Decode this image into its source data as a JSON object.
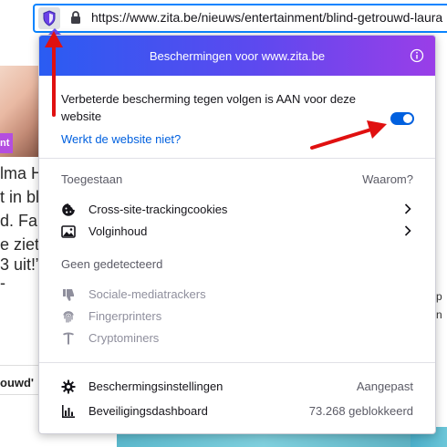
{
  "urlbar": {
    "url": "https://www.zita.be/nieuws/entertainment/blind-getrouwd-laura"
  },
  "background_page": {
    "badge": "nt",
    "lines": [
      "lma H",
      "t in bl",
      "d. Fan",
      "e ziet",
      "3 uit!”",
      "-"
    ],
    "bold_fragment": "ouwd'",
    "right_fragments": [
      "p",
      "n"
    ]
  },
  "panel": {
    "title": "Beschermingen voor www.zita.be",
    "status_message": "Verbeterde bescherming tegen volgen is AAN voor deze website",
    "toggle_on": true,
    "broken_link": "Werkt de website niet?",
    "allowed_heading": "Toegestaan",
    "why_link": "Waarom?",
    "allowed_items": [
      {
        "label": "Cross-site-trackingcookies",
        "icon": "cookie-icon"
      },
      {
        "label": "Volginhoud",
        "icon": "image-icon"
      }
    ],
    "not_detected_heading": "Geen gedetecteerd",
    "not_detected_items": [
      {
        "label": "Sociale-mediatrackers",
        "icon": "thumbs-down-icon"
      },
      {
        "label": "Fingerprinters",
        "icon": "fingerprint-icon"
      },
      {
        "label": "Cryptominers",
        "icon": "pickaxe-icon"
      }
    ],
    "settings_label": "Beschermingsinstellingen",
    "settings_value": "Aangepast",
    "dashboard_label": "Beveiligingsdashboard",
    "dashboard_value": "73.268 geblokkeerd"
  },
  "colors": {
    "accent_blue": "#0060df",
    "header_gradient_start": "#2a5cf2",
    "header_gradient_end": "#9a3ee8",
    "annotation_red": "#e01010"
  }
}
